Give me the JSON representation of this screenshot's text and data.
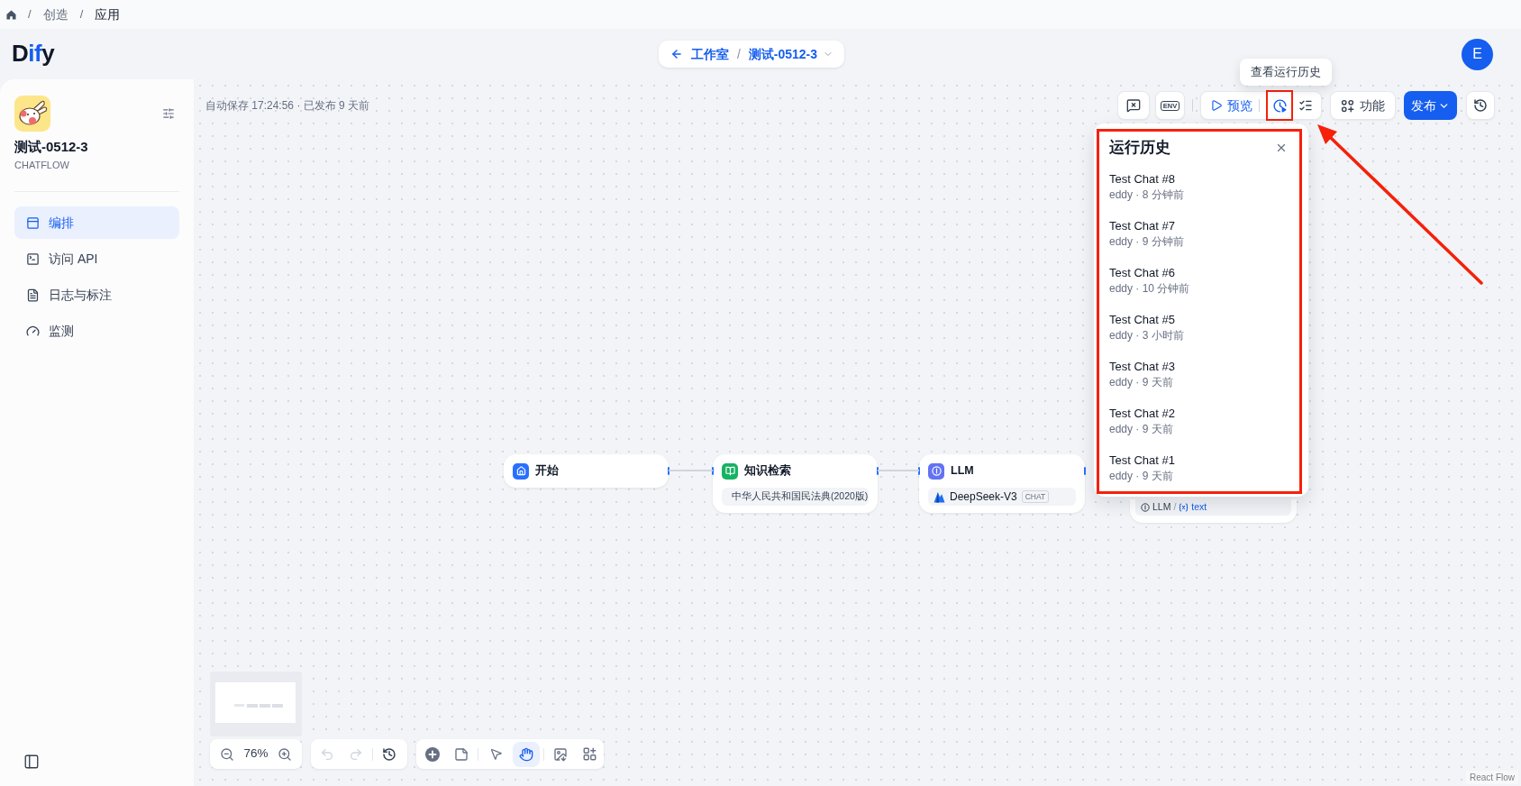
{
  "breadcrumb": [
    {
      "kind": "separator",
      "text": "/"
    },
    {
      "kind": "link",
      "text": "创造"
    },
    {
      "kind": "separator",
      "text": "/"
    },
    {
      "kind": "current",
      "text": "应用"
    }
  ],
  "header": {
    "logo": "Dify",
    "back_label": "工作室",
    "separator": "/",
    "app_name": "测试-0512-3",
    "avatar": "E"
  },
  "sidebar": {
    "app_name": "测试-0512-3",
    "app_type": "CHATFLOW",
    "nav": [
      {
        "label": "编排",
        "selected": true
      },
      {
        "label": "访问 API",
        "selected": false
      },
      {
        "label": "日志与标注",
        "selected": false
      },
      {
        "label": "监测",
        "selected": false
      }
    ]
  },
  "canvas": {
    "status": "自动保存 17:24:56 · 已发布 9 天前",
    "toolbar": {
      "env_label": "ENV",
      "preview_label": "预览",
      "features_label": "功能",
      "publish_label": "发布",
      "tooltip": "查看运行历史"
    },
    "run_history": {
      "open": true,
      "title": "运行历史",
      "runs": [
        {
          "title": "Test Chat #8",
          "meta": "eddy · 8 分钟前"
        },
        {
          "title": "Test Chat #7",
          "meta": "eddy · 9 分钟前"
        },
        {
          "title": "Test Chat #6",
          "meta": "eddy · 10 分钟前"
        },
        {
          "title": "Test Chat #5",
          "meta": "eddy · 3 小时前"
        },
        {
          "title": "Test Chat #3",
          "meta": "eddy · 9 天前"
        },
        {
          "title": "Test Chat #2",
          "meta": "eddy · 9 天前"
        },
        {
          "title": "Test Chat #1",
          "meta": "eddy · 9 天前"
        }
      ]
    },
    "nodes": [
      {
        "kind": "start",
        "title": "开始"
      },
      {
        "kind": "knowledge",
        "title": "知识检索",
        "detail": "中华人民共和国民法典(2020版)"
      },
      {
        "kind": "llm",
        "title": "LLM",
        "detail": "DeepSeek-V3",
        "badge": "CHAT"
      },
      {
        "kind": "answer",
        "source": "LLM",
        "separator": "/",
        "variable": "text"
      }
    ],
    "controls": {
      "zoom": "76%",
      "undo_disabled": true,
      "redo_disabled": true,
      "modes": [
        {
          "kind": "pointer",
          "selected": false
        },
        {
          "kind": "hand",
          "selected": true
        }
      ]
    },
    "attribution": "React Flow"
  }
}
